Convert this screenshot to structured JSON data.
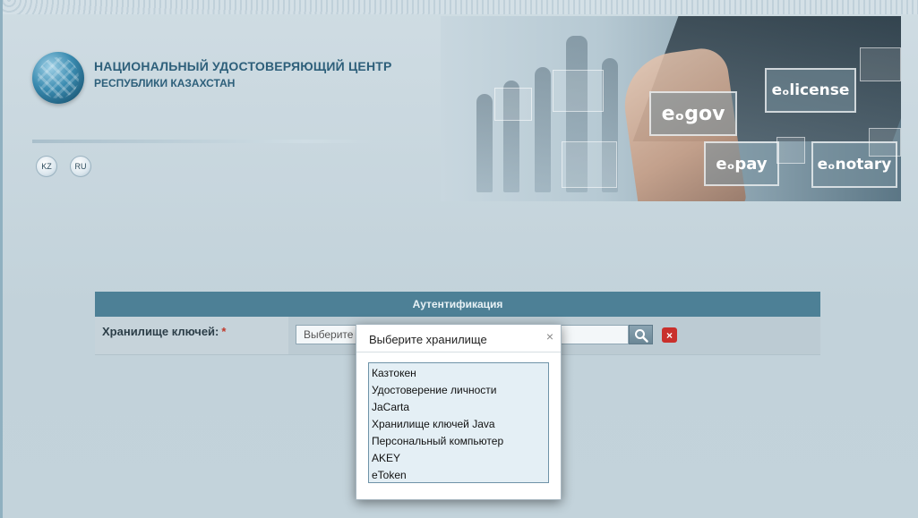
{
  "header": {
    "title": "НАЦИОНАЛЬНЫЙ УДОСТОВЕРЯЮЩИЙ ЦЕНТР",
    "subtitle": "РЕСПУБЛИКИ КАЗАХСТАН",
    "languages": [
      {
        "code": "KZ"
      },
      {
        "code": "RU"
      }
    ]
  },
  "banner": {
    "tiles": [
      "eₒgov",
      "eₒlicense",
      "eₒpay",
      "eₒnotary"
    ]
  },
  "auth": {
    "header": "Аутентификация",
    "store_label": "Хранилище ключей:",
    "required_mark": "*",
    "store_placeholder": "Выберите",
    "clear_label": "×"
  },
  "dialog": {
    "title": "Выберите хранилище",
    "close_label": "×",
    "options": [
      "Казтокен",
      "Удостоверение личности",
      "JaCarta",
      "Хранилище ключей Java",
      "Персональный компьютер",
      "AKEY",
      "eToken"
    ]
  },
  "colors": {
    "accent": "#4d8096",
    "title": "#2d5f7a",
    "danger": "#c9302c"
  }
}
